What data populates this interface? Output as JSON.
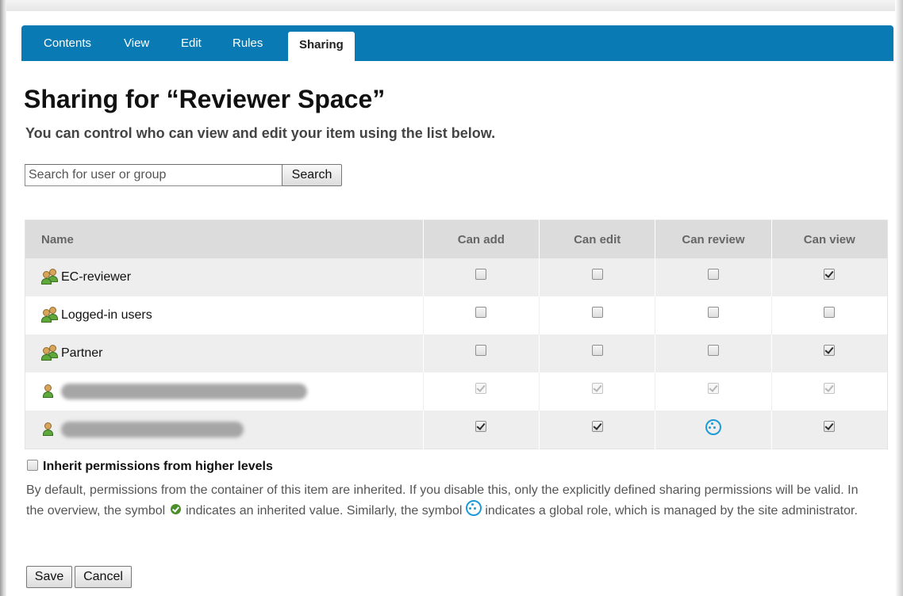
{
  "tabs": [
    "Contents",
    "View",
    "Edit",
    "Rules",
    "Sharing"
  ],
  "active_tab": "Sharing",
  "title": "Sharing for “Reviewer Space”",
  "subtitle": "You can control who can view and edit your item using the list below.",
  "search": {
    "placeholder": "Search for user or group",
    "button_label": "Search"
  },
  "table": {
    "columns": [
      "Name",
      "Can add",
      "Can edit",
      "Can review",
      "Can view"
    ],
    "rows": [
      {
        "type": "group",
        "name": "EC-reviewer",
        "permissions": [
          "unchecked",
          "unchecked",
          "unchecked",
          "checked"
        ]
      },
      {
        "type": "group",
        "name": "Logged-in users",
        "permissions": [
          "unchecked",
          "unchecked",
          "unchecked",
          "unchecked"
        ]
      },
      {
        "type": "group",
        "name": "Partner",
        "permissions": [
          "unchecked",
          "unchecked",
          "unchecked",
          "checked"
        ]
      },
      {
        "type": "user",
        "name": "",
        "redacted": true,
        "permissions": [
          "disabled-checked",
          "disabled-checked",
          "disabled-checked",
          "disabled-checked"
        ]
      },
      {
        "type": "user",
        "name": "",
        "redacted": true,
        "permissions": [
          "checked",
          "checked",
          "global-role",
          "checked"
        ]
      }
    ]
  },
  "inherit": {
    "label": "Inherit permissions from higher levels",
    "checked": false,
    "help_part1": "By default, permissions from the container of this item are inherited. If you disable this, only the explicitly defined sharing permissions will be valid. In the overview, the symbol",
    "help_part2": "indicates an inherited value. Similarly, the symbol",
    "help_part3": "indicates a global role, which is managed by the site administrator."
  },
  "buttons": {
    "save": "Save",
    "cancel": "Cancel"
  },
  "colors": {
    "tab_bar": "#0a7ab5",
    "header_row": "#dcdcdc",
    "global_role": "#1e9bd7",
    "inherited": "#4a8f2a"
  }
}
